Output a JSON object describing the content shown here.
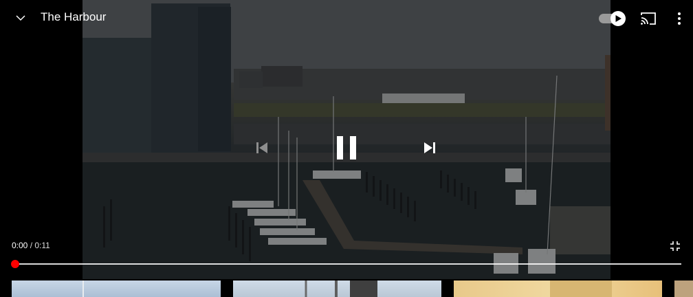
{
  "header": {
    "title": "The Harbour",
    "collapse_icon": "chevron-down-icon",
    "autoplay_icon": "autoplay-toggle-icon",
    "cast_icon": "cast-icon",
    "more_icon": "more-vert-icon"
  },
  "controls": {
    "previous_icon": "skip-previous-icon",
    "play_pause_icon": "pause-icon",
    "next_icon": "skip-next-icon",
    "exit_fullscreen_icon": "exit-fullscreen-icon"
  },
  "playback": {
    "current_time": "0:00",
    "separator": " / ",
    "duration": "0:11",
    "progress": 0.0
  },
  "colors": {
    "progress_accent": "#ff0000",
    "text": "#ffffff"
  }
}
